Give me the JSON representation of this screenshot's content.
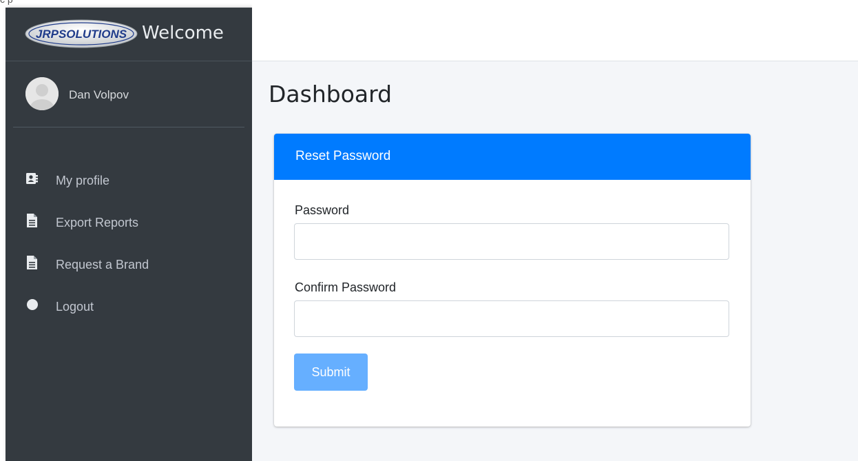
{
  "top_strip": {
    "text": "c p"
  },
  "brand": {
    "logo_text": "JRPSOLUTIONS",
    "title": "Welcome"
  },
  "user": {
    "name": "Dan Volpov"
  },
  "sidebar": {
    "items": [
      {
        "label": "My profile",
        "icon": "contact-card-icon"
      },
      {
        "label": "Export Reports",
        "icon": "document-icon"
      },
      {
        "label": "Request a Brand",
        "icon": "document-icon"
      },
      {
        "label": "Logout",
        "icon": "circle-icon"
      }
    ]
  },
  "main": {
    "page_title": "Dashboard",
    "card": {
      "title": "Reset Password",
      "fields": [
        {
          "label": "Password",
          "value": "",
          "placeholder": ""
        },
        {
          "label": "Confirm Password",
          "value": "",
          "placeholder": ""
        }
      ],
      "submit_label": "Submit"
    }
  },
  "colors": {
    "sidebar_bg": "#343a40",
    "primary": "#007bff",
    "submit_disabled": "#66afff",
    "content_bg": "#f4f6f9"
  }
}
